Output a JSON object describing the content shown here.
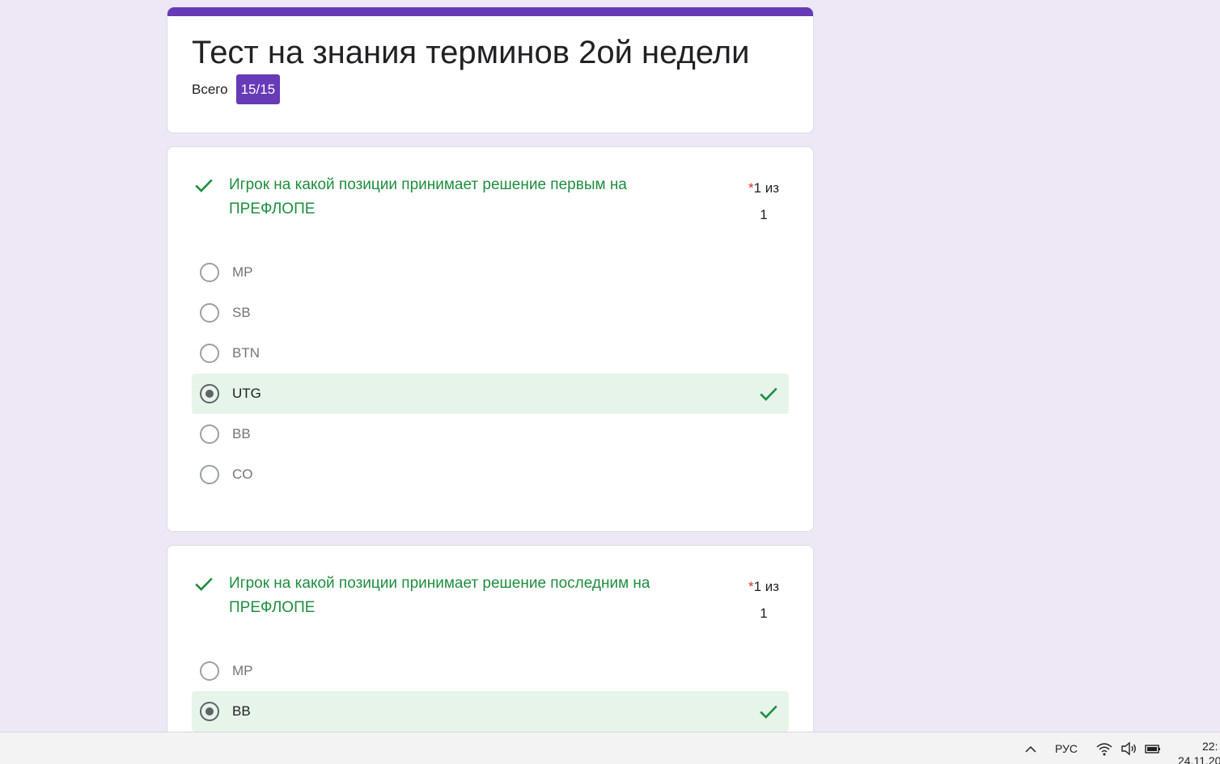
{
  "form": {
    "title": "Тест на знания терминов 2ой недели",
    "total_label": "Всего",
    "score": "15/15",
    "accent_color": "#673ab7"
  },
  "questions": [
    {
      "text": "Игрок на какой позиции принимает решение первым на ПРЕФЛОПЕ",
      "required_mark": "*",
      "points_line1": "1 из",
      "points_line2": "1",
      "status": "correct",
      "options": [
        {
          "label": "MP",
          "selected": false,
          "correct": false
        },
        {
          "label": "SB",
          "selected": false,
          "correct": false
        },
        {
          "label": "BTN",
          "selected": false,
          "correct": false
        },
        {
          "label": "UTG",
          "selected": true,
          "correct": true
        },
        {
          "label": "BB",
          "selected": false,
          "correct": false
        },
        {
          "label": "CO",
          "selected": false,
          "correct": false
        }
      ]
    },
    {
      "text": "Игрок на какой позиции принимает решение последним на ПРЕФЛОПЕ",
      "required_mark": "*",
      "points_line1": "1 из",
      "points_line2": "1",
      "status": "correct",
      "options": [
        {
          "label": "MP",
          "selected": false,
          "correct": false
        },
        {
          "label": "BB",
          "selected": true,
          "correct": true
        }
      ]
    }
  ],
  "taskbar": {
    "language": "РУС",
    "time": "22:",
    "date": "24.11.20",
    "icons": [
      "chevron-up-icon",
      "wifi-icon",
      "volume-icon",
      "battery-icon"
    ]
  },
  "colors": {
    "correct_green": "#1e8e3e",
    "correct_bg": "#e6f4ea",
    "page_bg": "#ede7f6"
  }
}
